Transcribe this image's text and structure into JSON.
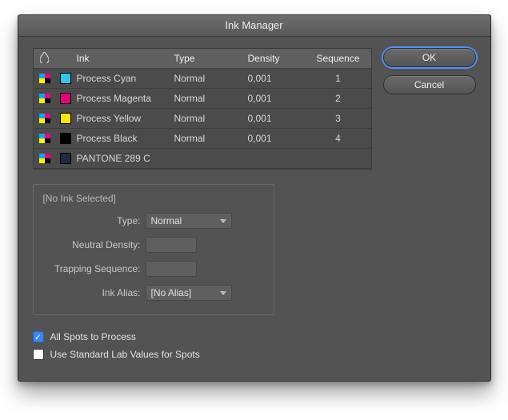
{
  "dialog": {
    "title": "Ink Manager"
  },
  "headers": {
    "ink": "Ink",
    "type": "Type",
    "density": "Density",
    "sequence": "Sequence"
  },
  "inks": [
    {
      "name": "Process Cyan",
      "color": "#2FC4F2",
      "type": "Normal",
      "density": "0,001",
      "sequence": "1"
    },
    {
      "name": "Process Magenta",
      "color": "#E6007E",
      "type": "Normal",
      "density": "0,001",
      "sequence": "2"
    },
    {
      "name": "Process Yellow",
      "color": "#FCE500",
      "type": "Normal",
      "density": "0,001",
      "sequence": "3"
    },
    {
      "name": "Process Black",
      "color": "#000000",
      "type": "Normal",
      "density": "0,001",
      "sequence": "4"
    },
    {
      "name": "PANTONE 289 C",
      "color": "#1C2A4A",
      "type": "",
      "density": "",
      "sequence": ""
    }
  ],
  "detail": {
    "legend": "[No Ink Selected]",
    "type_label": "Type:",
    "type_value": "Normal",
    "density_label": "Neutral Density:",
    "density_value": "",
    "sequence_label": "Trapping Sequence:",
    "sequence_value": "",
    "alias_label": "Ink Alias:",
    "alias_value": "[No Alias]"
  },
  "options": {
    "all_spots": {
      "label": "All Spots to Process",
      "checked": true
    },
    "lab_values": {
      "label": "Use Standard Lab Values for Spots",
      "checked": false
    }
  },
  "buttons": {
    "ok": "OK",
    "cancel": "Cancel"
  }
}
